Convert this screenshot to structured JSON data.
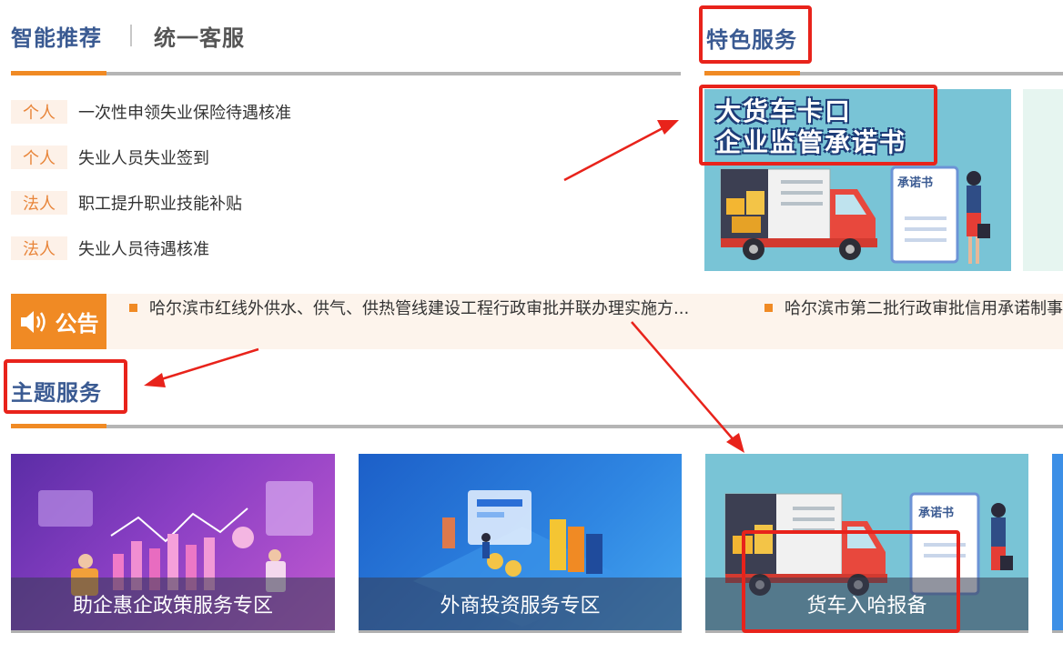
{
  "tabs": {
    "recommend": "智能推荐",
    "service": "统一客服"
  },
  "featured": {
    "title": "特色服务",
    "banner_line1": "大货车卡口",
    "banner_line2": "企业监管承诺书",
    "doc_label": "承诺书"
  },
  "recommendations": [
    {
      "tag": "个人",
      "text": "一次性申领失业保险待遇核准"
    },
    {
      "tag": "个人",
      "text": "失业人员失业签到"
    },
    {
      "tag": "法人",
      "text": "职工提升职业技能补贴"
    },
    {
      "tag": "法人",
      "text": "失业人员待遇核准"
    }
  ],
  "notice": {
    "badge": "公告",
    "items": [
      "哈尔滨市红线外供水、供气、供热管线建设工程行政审批并联办理实施方...",
      "哈尔滨市第二批行政审批信用承诺制事"
    ]
  },
  "theme": {
    "title": "主题服务",
    "cards": [
      {
        "caption": "助企惠企政策服务专区"
      },
      {
        "caption": "外商投资服务专区"
      },
      {
        "caption": "货车入哈报备",
        "doc_label": "承诺书"
      }
    ]
  },
  "colors": {
    "accent": "#f08a24",
    "title_blue": "#3a5a92",
    "annotation_red": "#e8231b"
  }
}
